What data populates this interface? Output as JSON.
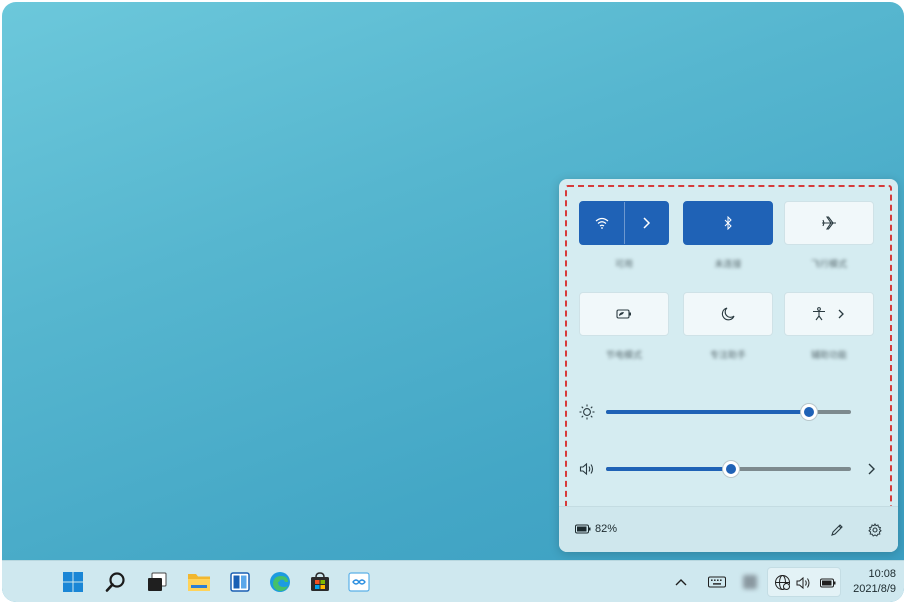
{
  "quick_settings": {
    "tiles": [
      {
        "name": "wifi",
        "label": "可用",
        "active": true,
        "icon": "wifi-icon",
        "has_chevron": true
      },
      {
        "name": "bluetooth",
        "label": "未连接",
        "active": true,
        "icon": "bluetooth-icon",
        "has_chevron": false
      },
      {
        "name": "airplane",
        "label": "飞行模式",
        "active": false,
        "icon": "airplane-icon",
        "has_chevron": false
      },
      {
        "name": "battery-saver",
        "label": "节电模式",
        "active": false,
        "icon": "battery-saver-icon",
        "has_chevron": false
      },
      {
        "name": "focus",
        "label": "专注助手",
        "active": false,
        "icon": "moon-icon",
        "has_chevron": false
      },
      {
        "name": "accessibility",
        "label": "辅助功能",
        "active": false,
        "icon": "accessibility-icon",
        "has_chevron": true
      }
    ],
    "brightness": {
      "icon": "sun-icon",
      "value_pct": 83
    },
    "volume": {
      "icon": "speaker-icon",
      "value_pct": 51
    },
    "battery_text": "82%",
    "footer_icons": [
      "pencil-icon",
      "gear-icon"
    ]
  },
  "taskbar": {
    "apps": [
      "windows-start-icon",
      "search-icon",
      "task-view-icon",
      "file-explorer-icon",
      "widgets-icon",
      "edge-icon",
      "store-icon",
      "app-icon"
    ],
    "tray": [
      "chevron-up-icon",
      "keyboard-icon",
      "blurred-icon",
      "network-icon",
      "volume-icon",
      "battery-icon"
    ],
    "clock_time": "10:08",
    "clock_date": "2021/8/9"
  },
  "colors": {
    "accent": "#1f62b6",
    "dash_outline": "#d63b3b",
    "desktop": "#4aaecb"
  }
}
